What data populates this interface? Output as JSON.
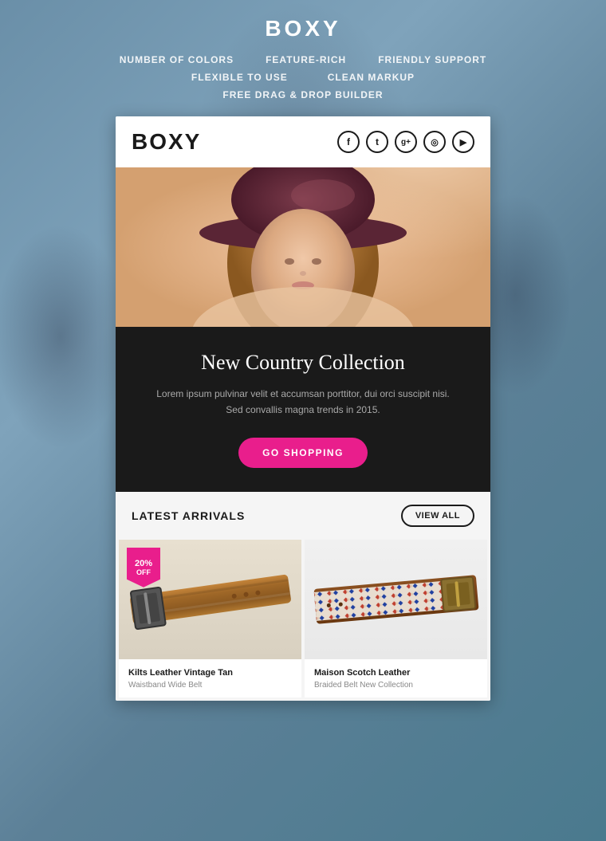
{
  "page": {
    "bg_color": "#7a9fb5"
  },
  "header": {
    "title": "BOXY",
    "features_row1": [
      {
        "label": "NUMBER OF COLORS"
      },
      {
        "label": "FEATURE-RICH"
      },
      {
        "label": "FRIENDLY SUPPORT"
      }
    ],
    "features_row2": [
      {
        "label": "FLEXIBLE TO USE"
      },
      {
        "label": "CLEAN MARKUP"
      }
    ],
    "features_row3": [
      {
        "label": "FREE DRAG & DROP BUILDER"
      }
    ]
  },
  "email": {
    "logo": "BOXY",
    "social_icons": [
      {
        "name": "facebook-icon",
        "symbol": "f"
      },
      {
        "name": "twitter-icon",
        "symbol": "t"
      },
      {
        "name": "googleplus-icon",
        "symbol": "g+"
      },
      {
        "name": "instagram-icon",
        "symbol": "◎"
      },
      {
        "name": "youtube-icon",
        "symbol": "▶"
      }
    ],
    "hero": {
      "title": "New Country Collection",
      "description": "Lorem ipsum pulvinar velit et accumsan porttitor, dui orci suscipit nisi. Sed convallis magna trends in 2015.",
      "cta_label": "GO SHOPPING"
    },
    "latest_arrivals": {
      "section_title": "LATEST ARRIVALS",
      "view_all_label": "VIEW ALL",
      "products": [
        {
          "name": "Kilts Leather Vintage Tan",
          "sub": "Waistband Wide Belt",
          "has_discount": true,
          "discount_pct": "20%",
          "discount_off": "OFF"
        },
        {
          "name": "Maison Scotch Leather",
          "sub": "Braided Belt New Collection",
          "has_discount": false
        }
      ]
    }
  }
}
